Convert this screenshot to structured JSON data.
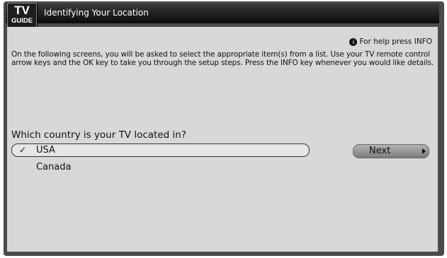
{
  "header": {
    "logo_top": "TV",
    "logo_bottom": "GUIDE",
    "title": "Identifying Your Location"
  },
  "help": {
    "icon_glyph": "i",
    "text": "For help press INFO"
  },
  "intro_text": "On the following screens, you will be asked to select the appropriate item(s) from a list. Use your TV remote control arrow keys and the OK key to take you through the setup steps. Press the INFO key whenever you would like details.",
  "question": "Which country is your TV located in?",
  "options": [
    {
      "label": "USA",
      "selected": true
    },
    {
      "label": "Canada",
      "selected": false
    }
  ],
  "check_glyph": "✓",
  "next_label": "Next"
}
